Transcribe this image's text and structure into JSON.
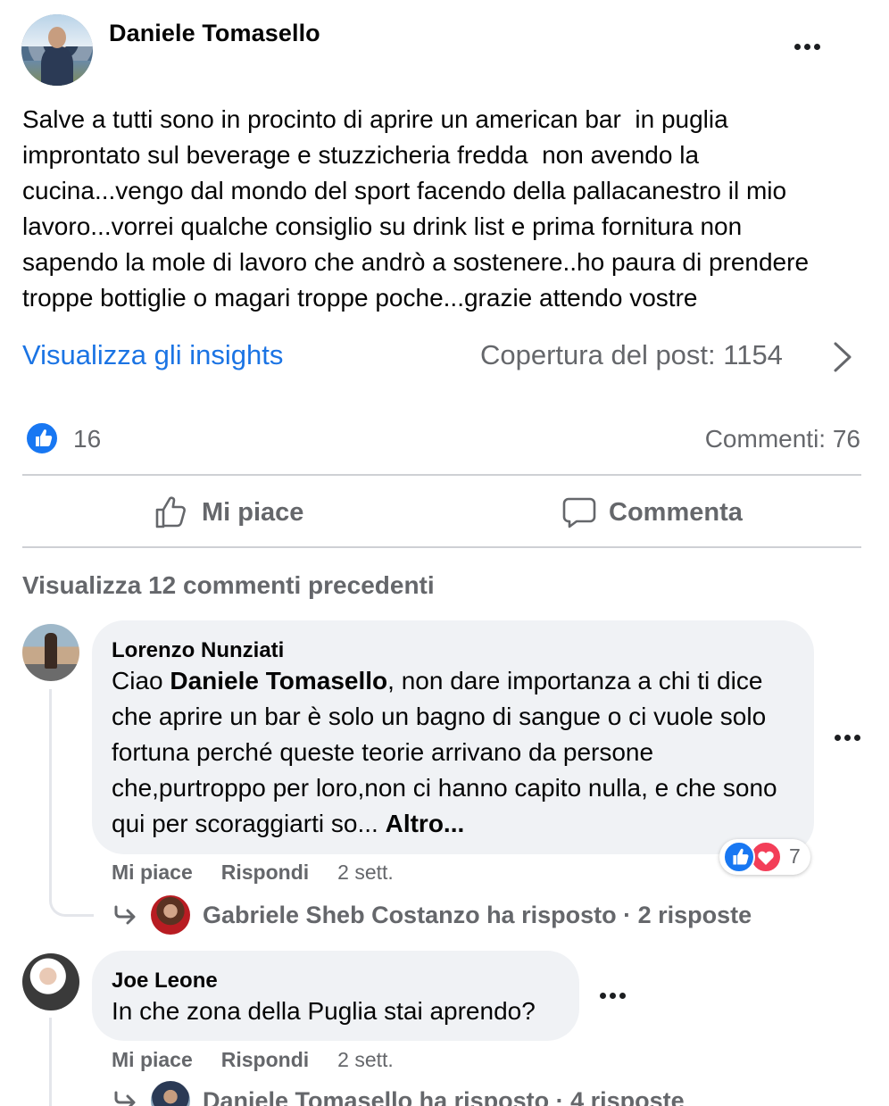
{
  "post": {
    "author": "Daniele Tomasello",
    "text": "Salve a tutti sono in procinto di aprire un american bar  in puglia\nimprontato sul beverage e stuzzicheria fredda  non avendo la\ncucina...vengo dal mondo del sport facendo della pallacanestro il mio\nlavoro...vorrei qualche consiglio su drink list e prima fornitura non\nsapendo la mole di lavoro che andrò a sostenere..ho paura di prendere\ntroppe bottiglie o magari troppe poche...grazie attendo vostre",
    "insights_link": "Visualizza gli insights",
    "reach": "Copertura del post: 1154",
    "reactions_count": "16",
    "comments_count": "Commenti: 76",
    "like_label": "Mi piace",
    "comment_label": "Commenta"
  },
  "comments_section": {
    "view_previous": "Visualizza 12 commenti precedenti",
    "comments": [
      {
        "author": "Lorenzo Nunziati",
        "text_prefix": "Ciao ",
        "mention": "Daniele Tomasello",
        "text_rest": ", non dare importanza a chi ti dice che aprire un bar è solo un bagno di sangue o ci vuole solo fortuna perché queste teorie arrivano da persone che,purtroppo per loro,non ci hanno capito nulla, e che sono qui per scoraggiarti so... ",
        "more_label": "Altro...",
        "like_label": "Mi piace",
        "reply_label": "Rispondi",
        "time": "2 sett.",
        "reaction_count": "7",
        "replies_summary": "Gabriele Sheb Costanzo ha risposto · 2 risposte"
      },
      {
        "author": "Joe Leone",
        "text": "In che zona della Puglia stai aprendo?",
        "like_label": "Mi piace",
        "reply_label": "Rispondi",
        "time": "2 sett.",
        "replies_summary": "Daniele Tomasello ha risposto · 4 risposte"
      }
    ]
  },
  "colors": {
    "accent_blue": "#1b74e4",
    "like_blue": "#1877f2",
    "love_red": "#f33e58",
    "secondary_text": "#65676b",
    "bubble_bg": "#f0f2f5"
  },
  "icons": [
    "more-icon",
    "chevron-right-icon",
    "like-reaction-icon",
    "thumb-up-outline-icon",
    "comment-outline-icon",
    "love-reaction-icon",
    "reply-arrow-icon"
  ]
}
